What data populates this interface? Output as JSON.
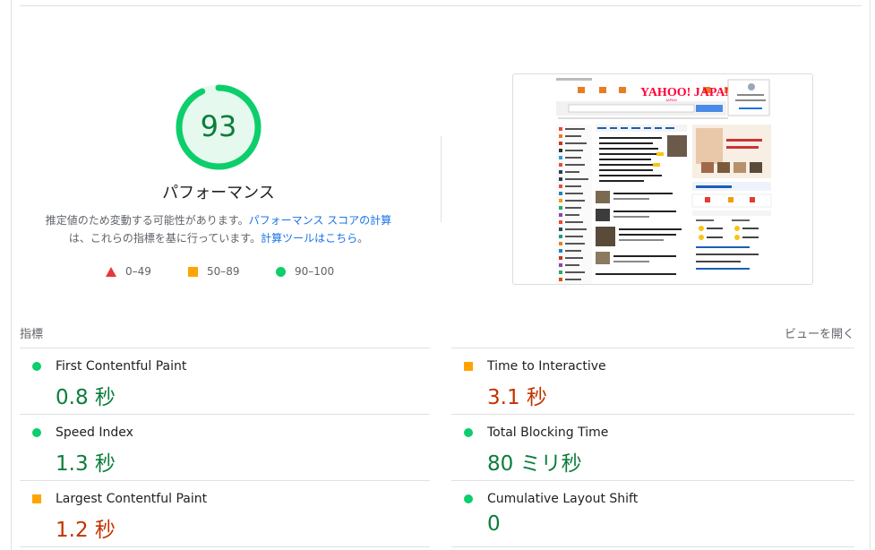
{
  "summary": {
    "score": "93",
    "category": "パフォーマンス",
    "note_prefix": "推定値のため変動する可能性があります。",
    "note_link1": "パフォーマンス スコアの計算",
    "note_middle": "は、これらの指標を基に行っています。",
    "note_link2": "計算ツールはこちら",
    "note_suffix": "。"
  },
  "legend": [
    {
      "range": "0–49",
      "shape": "triangle",
      "color": "#e53935"
    },
    {
      "range": "50–89",
      "shape": "square",
      "color": "#ffa400"
    },
    {
      "range": "90–100",
      "shape": "circle",
      "color": "#0cce6b"
    }
  ],
  "metrics_section": {
    "title": "指標",
    "expand_label": "ビューを開く"
  },
  "metrics": [
    {
      "name": "First Contentful Paint",
      "value": "0.8 秒",
      "rating": "pass"
    },
    {
      "name": "Time to Interactive",
      "value": "3.1 秒",
      "rating": "average"
    },
    {
      "name": "Speed Index",
      "value": "1.3 秒",
      "rating": "pass"
    },
    {
      "name": "Total Blocking Time",
      "value": "80 ミリ秒",
      "rating": "pass"
    },
    {
      "name": "Largest Contentful Paint",
      "value": "1.2 秒",
      "rating": "average"
    },
    {
      "name": "Cumulative Layout Shift",
      "value": "0",
      "rating": "pass"
    }
  ],
  "screenshot": {
    "logo": "YAHOO! JAPAN",
    "search_button": "検索",
    "nav_items": [
      "ショッピング",
      "ヤフオク!",
      "PayPayフリマ",
      "ZOZOTOWN",
      "LOHACO",
      "トラベル",
      "一休.com",
      "一休.comレストラン",
      "出前館",
      "ニュース",
      "天気・災害",
      "スポーツナビ",
      "ファイナンス",
      "テレビ",
      "映画",
      "GYAO!",
      "Yahoo!ゲーム",
      "ゲーム",
      "Yahoo!モバゲー",
      "Yahoo!Japan",
      "占い",
      "路線情報"
    ]
  },
  "colors": {
    "pass": "#0c7d3c",
    "average": "#c33300",
    "gauge": "#0cce6b",
    "gauge_bg": "#e6f9ef",
    "link": "#1a73e8"
  }
}
